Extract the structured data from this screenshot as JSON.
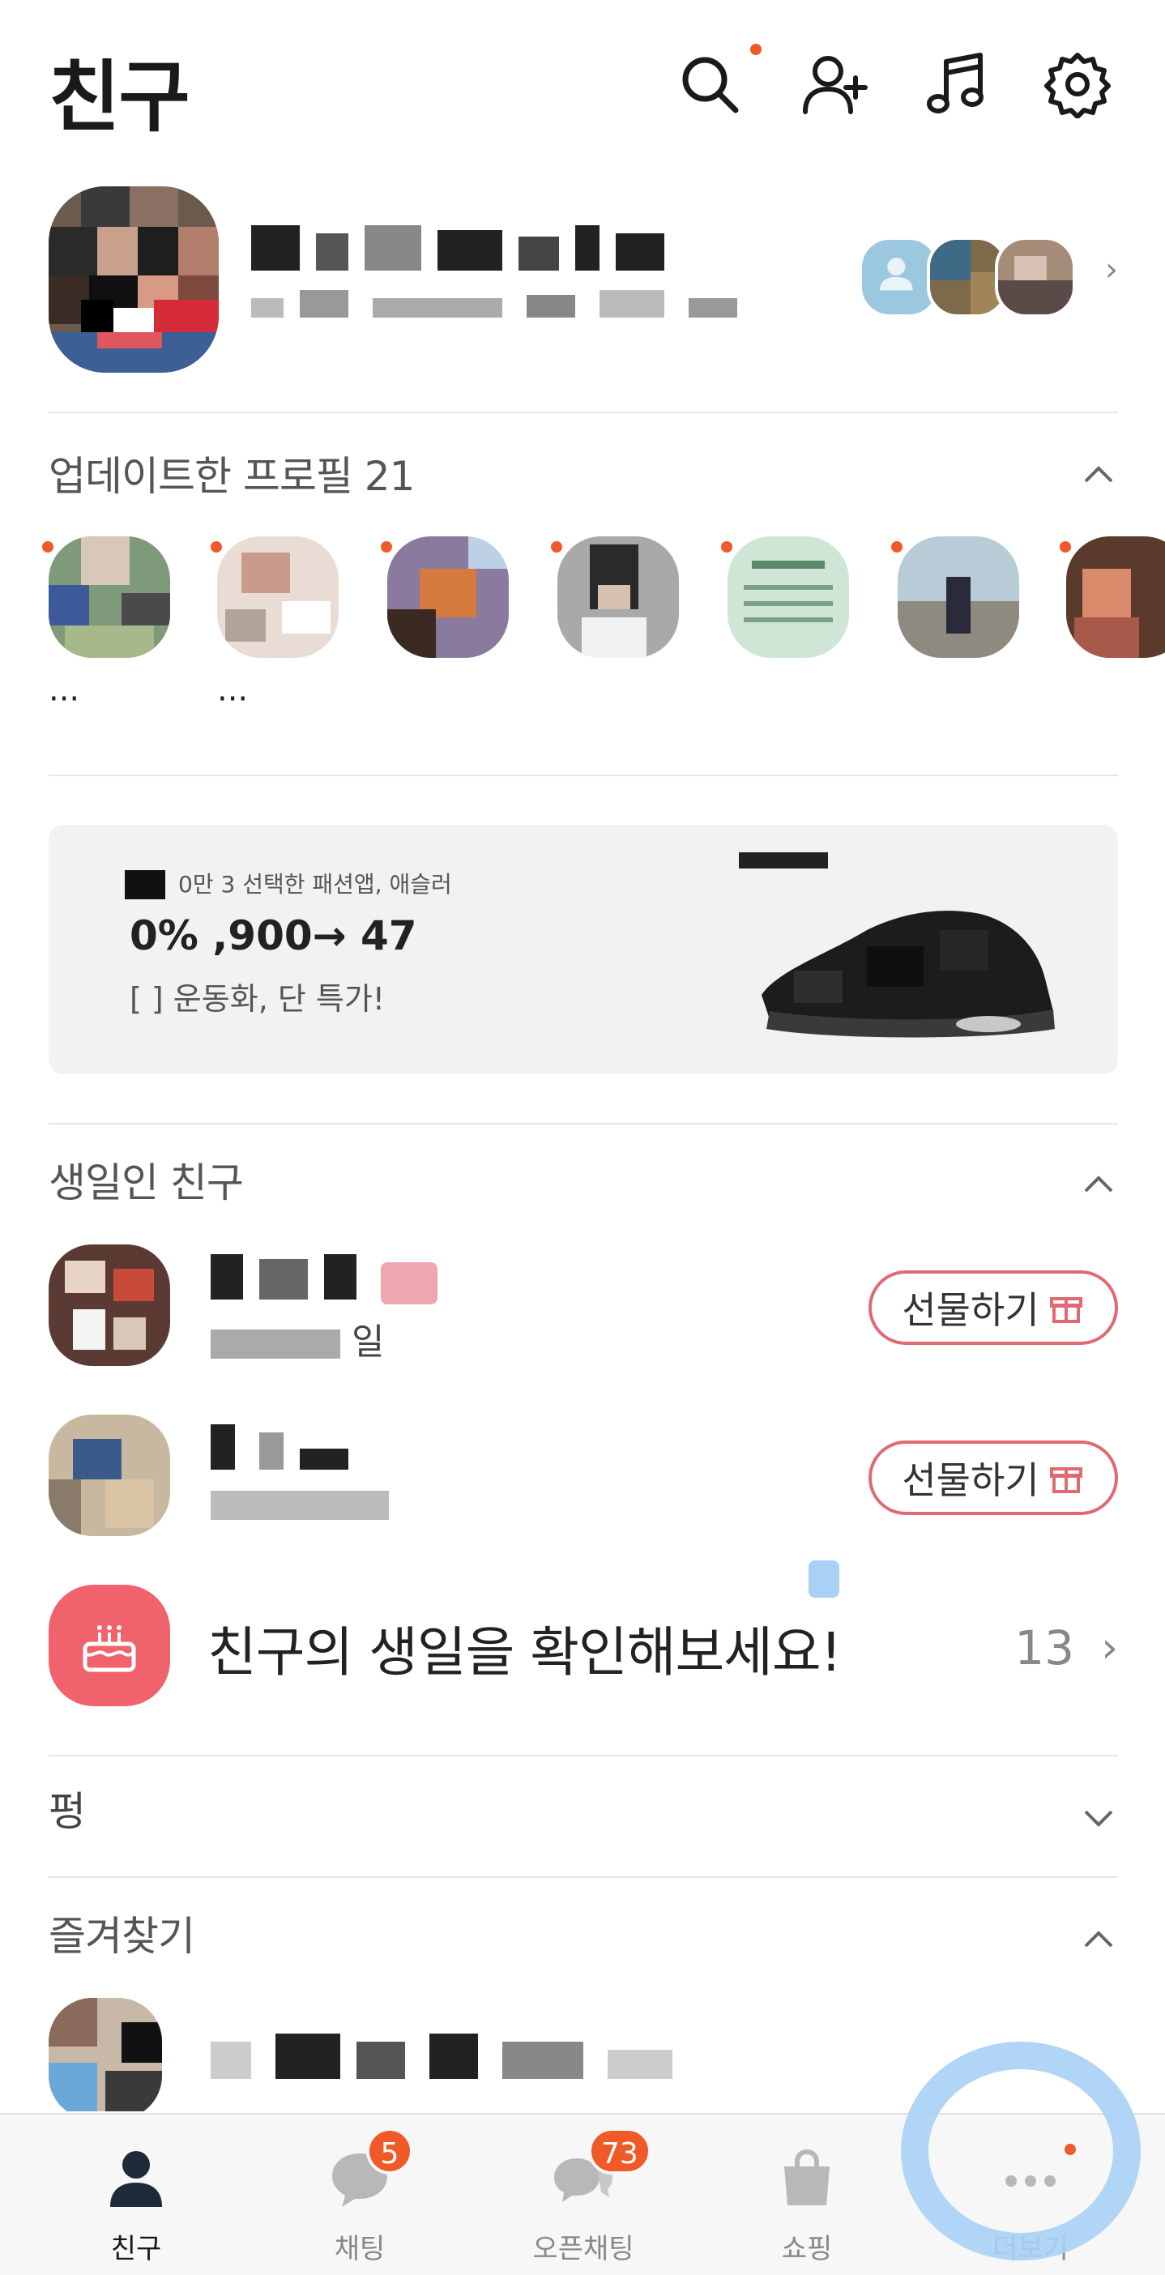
{
  "header": {
    "title": "친구",
    "icons": [
      "search-icon",
      "add-friend-icon",
      "music-icon",
      "settings-icon"
    ]
  },
  "my_profile": {
    "name": "",
    "status": ""
  },
  "updated_profiles": {
    "title": "업데이트한 프로필 21",
    "items": [
      {
        "label": "···"
      },
      {
        "label": "···"
      },
      {
        "label": ""
      },
      {
        "label": ""
      },
      {
        "label": ""
      },
      {
        "label": ""
      },
      {
        "label": ""
      }
    ]
  },
  "ad": {
    "line1": "0만 3  선택한 패션앱, 애슬러",
    "line2": "0%  ,900→ 47",
    "line3": "[  ]  운동화, 단 특가!"
  },
  "birthday": {
    "title": "생일인 친구",
    "rows": [
      {
        "sub": "일",
        "gift_label": "선물하기"
      },
      {
        "sub": "",
        "gift_label": "선물하기"
      }
    ],
    "check_text": "친구의 생일을 확인해보세요!",
    "check_count": "13"
  },
  "pung": {
    "title": "펑"
  },
  "favorites": {
    "title": "즐겨찾기"
  },
  "nav": {
    "items": [
      {
        "label": "친구",
        "icon": "person-icon"
      },
      {
        "label": "채팅",
        "icon": "chat-icon",
        "badge": "5"
      },
      {
        "label": "오픈채팅",
        "icon": "open-chat-icon",
        "badge": "73"
      },
      {
        "label": "쇼핑",
        "icon": "shopping-bag-icon"
      },
      {
        "label": "더보기",
        "icon": "more-icon"
      }
    ]
  },
  "colors": {
    "accent": "#f05a28",
    "gift_border": "#e06a72",
    "cake_bg": "#f0626c",
    "annotation": "#a9d0f5"
  }
}
